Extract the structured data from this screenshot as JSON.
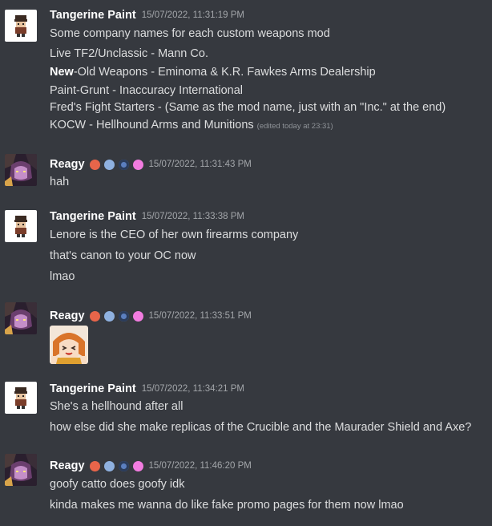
{
  "messages": [
    {
      "author": "Tangerine Paint",
      "timestamp": "15/07/2022, 11:31:19 PM",
      "lines": [
        "Some company names for each custom weapons mod",
        "Live TF2/Unclassic - Mann Co.",
        "-Old Weapons - Eminoma & K.R. Fawkes Arms Dealership",
        "Paint-Grunt - Inaccuracy International",
        "Fred's Fight Starters - (Same as the mod name, just with an \"Inc.\" at the end)",
        "KOCW - Hellhound Arms and Munitions"
      ],
      "bold_word": "New",
      "edited": "(edited today at 23:31)"
    },
    {
      "author": "Reagy",
      "timestamp": "15/07/2022, 11:31:43 PM",
      "lines": [
        "hah"
      ]
    },
    {
      "author": "Tangerine Paint",
      "timestamp": "15/07/2022, 11:33:38 PM",
      "lines": [
        "Lenore is the CEO of her own firearms company",
        "that's canon to your OC now",
        "lmao"
      ]
    },
    {
      "author": "Reagy",
      "timestamp": "15/07/2022, 11:33:51 PM",
      "lines": []
    },
    {
      "author": "Tangerine Paint",
      "timestamp": "15/07/2022, 11:34:21 PM",
      "lines": [
        "She's a hellhound after all",
        "how else did she make replicas of the Crucible and the Maurader Shield and Axe?"
      ]
    },
    {
      "author": "Reagy",
      "timestamp": "15/07/2022, 11:46:20 PM",
      "lines": [
        "goofy catto does goofy idk",
        "kinda makes me wanna do like fake promo pages for them now lmao"
      ]
    }
  ],
  "colors": {
    "background": "#36393f",
    "text": "#dcddde",
    "username": "#ffffff",
    "timestamp": "#a3a6aa"
  },
  "icons": {
    "tangerine_avatar": "pixel-character-avatar",
    "reagy_avatar": "anime-character-avatar",
    "reagy_badges": [
      "heart-badge-icon",
      "chat-badge-icon",
      "eye-badge-icon",
      "star-badge-icon"
    ],
    "sticker": "anime-girl-sticker"
  }
}
